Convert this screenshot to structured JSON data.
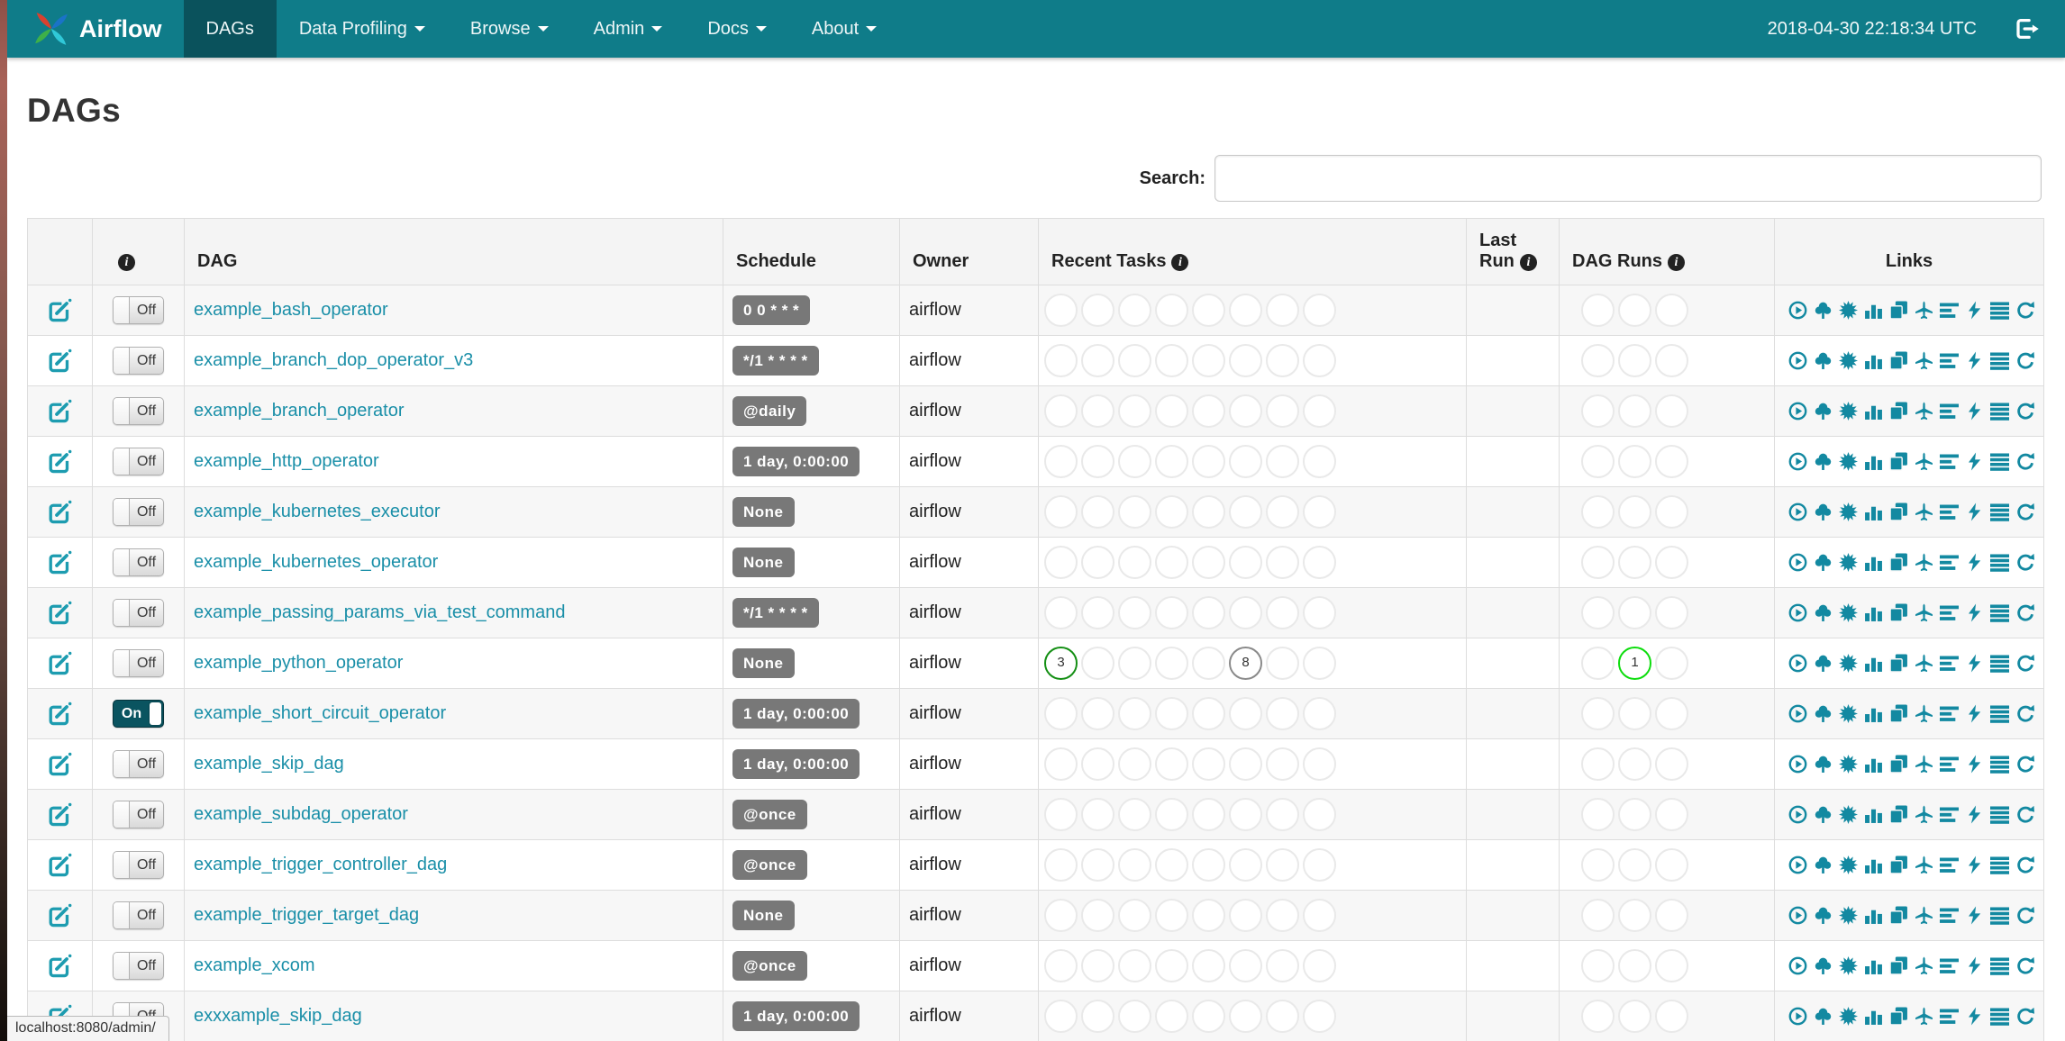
{
  "navbar": {
    "brand": "Airflow",
    "items": [
      {
        "label": "DAGs",
        "active": true,
        "dropdown": false
      },
      {
        "label": "Data Profiling",
        "active": false,
        "dropdown": true
      },
      {
        "label": "Browse",
        "active": false,
        "dropdown": true
      },
      {
        "label": "Admin",
        "active": false,
        "dropdown": true
      },
      {
        "label": "Docs",
        "active": false,
        "dropdown": true
      },
      {
        "label": "About",
        "active": false,
        "dropdown": true
      }
    ],
    "clock": "2018-04-30 22:18:34 UTC"
  },
  "page": {
    "title": "DAGs",
    "search_label": "Search:",
    "search_value": "",
    "status_text": "localhost:8080/admin/"
  },
  "table": {
    "headers": {
      "dag": "DAG",
      "schedule": "Schedule",
      "owner": "Owner",
      "recent_tasks": "Recent Tasks",
      "last_run": "Last Run",
      "dag_runs": "DAG Runs",
      "links": "Links"
    },
    "info_icon_glyph": "i",
    "recent_task_slots": 8,
    "dag_run_slots": 3,
    "link_icons": [
      "trigger-dag",
      "tree-view",
      "graph-view",
      "task-duration",
      "task-tries",
      "landing-times",
      "gantt-view",
      "code-view",
      "logs",
      "refresh"
    ],
    "rows": [
      {
        "name": "example_bash_operator",
        "toggle": "Off",
        "schedule": "0 0 * * *",
        "owner": "airflow",
        "recent_tasks": [],
        "dag_runs": []
      },
      {
        "name": "example_branch_dop_operator_v3",
        "toggle": "Off",
        "schedule": "*/1 * * * *",
        "owner": "airflow",
        "recent_tasks": [],
        "dag_runs": []
      },
      {
        "name": "example_branch_operator",
        "toggle": "Off",
        "schedule": "@daily",
        "owner": "airflow",
        "recent_tasks": [],
        "dag_runs": []
      },
      {
        "name": "example_http_operator",
        "toggle": "Off",
        "schedule": "1 day, 0:00:00",
        "owner": "airflow",
        "recent_tasks": [],
        "dag_runs": []
      },
      {
        "name": "example_kubernetes_executor",
        "toggle": "Off",
        "schedule": "None",
        "owner": "airflow",
        "recent_tasks": [],
        "dag_runs": []
      },
      {
        "name": "example_kubernetes_operator",
        "toggle": "Off",
        "schedule": "None",
        "owner": "airflow",
        "recent_tasks": [],
        "dag_runs": []
      },
      {
        "name": "example_passing_params_via_test_command",
        "toggle": "Off",
        "schedule": "*/1 * * * *",
        "owner": "airflow",
        "recent_tasks": [],
        "dag_runs": []
      },
      {
        "name": "example_python_operator",
        "toggle": "Off",
        "schedule": "None",
        "owner": "airflow",
        "recent_tasks": [
          {
            "slot": 1,
            "count": "3",
            "color": "#148f14"
          },
          {
            "slot": 6,
            "count": "8",
            "color": "#8a8a8a"
          }
        ],
        "dag_runs": [
          {
            "slot": 2,
            "count": "1",
            "color": "#0ddd0d"
          }
        ]
      },
      {
        "name": "example_short_circuit_operator",
        "toggle": "On",
        "schedule": "1 day, 0:00:00",
        "owner": "airflow",
        "recent_tasks": [],
        "dag_runs": []
      },
      {
        "name": "example_skip_dag",
        "toggle": "Off",
        "schedule": "1 day, 0:00:00",
        "owner": "airflow",
        "recent_tasks": [],
        "dag_runs": []
      },
      {
        "name": "example_subdag_operator",
        "toggle": "Off",
        "schedule": "@once",
        "owner": "airflow",
        "recent_tasks": [],
        "dag_runs": []
      },
      {
        "name": "example_trigger_controller_dag",
        "toggle": "Off",
        "schedule": "@once",
        "owner": "airflow",
        "recent_tasks": [],
        "dag_runs": []
      },
      {
        "name": "example_trigger_target_dag",
        "toggle": "Off",
        "schedule": "None",
        "owner": "airflow",
        "recent_tasks": [],
        "dag_runs": []
      },
      {
        "name": "example_xcom",
        "toggle": "Off",
        "schedule": "@once",
        "owner": "airflow",
        "recent_tasks": [],
        "dag_runs": []
      },
      {
        "name": "exxxample_skip_dag",
        "toggle": "Off",
        "schedule": "1 day, 0:00:00",
        "owner": "airflow",
        "recent_tasks": [],
        "dag_runs": []
      }
    ]
  },
  "colors": {
    "navbar": "#0f7c89",
    "navbar_active": "#0a525c",
    "link_teal": "#1a8fa8",
    "icon_teal": "#1389a1",
    "badge_gray": "#787878",
    "success_green": "#148f14",
    "running_lime": "#0ddd0d",
    "queued_gray": "#8a8a8a",
    "empty_ring": "#e9e9e9"
  }
}
